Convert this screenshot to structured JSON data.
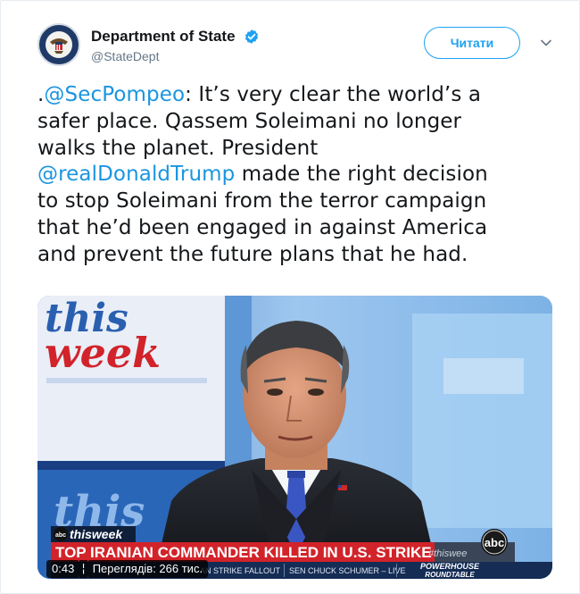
{
  "account": {
    "display_name": "Department of State",
    "handle": "@StateDept",
    "verified": true,
    "avatar_icon": "state-department-seal-icon"
  },
  "actions": {
    "follow_label": "Читати",
    "more_icon": "chevron-down-icon"
  },
  "tweet": {
    "lines": [
      [
        {
          "t": ".",
          "m": false
        },
        {
          "t": "@SecPompeo",
          "m": true
        },
        {
          "t": ": It’s very clear the world’s a",
          "m": false
        }
      ],
      [
        {
          "t": "safer place. Qassem Soleimani no longer",
          "m": false
        }
      ],
      [
        {
          "t": "walks the planet. President",
          "m": false
        }
      ],
      [
        {
          "t": "@realDonaldTrump",
          "m": true
        },
        {
          "t": " made the right decision",
          "m": false
        }
      ],
      [
        {
          "t": "to stop Soleimani from the terror campaign",
          "m": false
        }
      ],
      [
        {
          "t": "that he’d been engaged in against America",
          "m": false
        }
      ],
      [
        {
          "t": "and prevent the future plans that he had.",
          "m": false
        }
      ]
    ]
  },
  "video": {
    "show_logo_top": "this",
    "show_logo_bottom": "week",
    "show_logo_lower": "this",
    "bug_label": "thisweek",
    "headline": "TOP IRANIAN COMMANDER KILLED IN U.S. STRIKE",
    "hashtag": "#thiswee",
    "network_logo": "abc",
    "ticker": {
      "item1": "AN STRIKE FALLOUT",
      "item2": "SEN CHUCK SCHUMER – LIVE",
      "item3_line1": "POWERHOUSE",
      "item3_line2": "ROUNDTABLE"
    },
    "time": "0:43",
    "views": "Переглядів: 266 тис."
  },
  "colors": {
    "link": "#1b95e0",
    "follow_border": "#1da1f2",
    "headline_bar": "#d2232a"
  }
}
